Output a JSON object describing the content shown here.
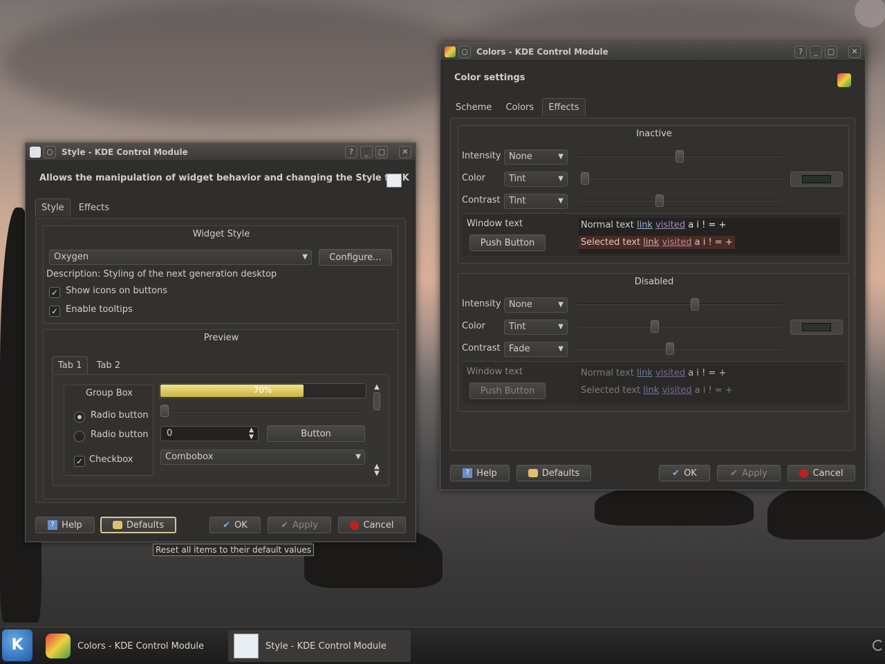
{
  "desktop": {},
  "style_window": {
    "title": "Style - KDE Control Module",
    "header": "Allows the manipulation of widget behavior and changing the Style for K",
    "tabs": [
      "Style",
      "Effects"
    ],
    "widget_style_group": "Widget Style",
    "style_combo": "Oxygen",
    "configure_label": "Configure...",
    "description": "Description: Styling of the next generation desktop",
    "show_icons_label": "Show icons on buttons",
    "enable_tooltips_label": "Enable tooltips",
    "preview_group": "Preview",
    "preview_tabs": [
      "Tab 1",
      "Tab 2"
    ],
    "group_box_label": "Group Box",
    "radio1": "Radio button",
    "radio2": "Radio button",
    "checkbox": "Checkbox",
    "progress_text": "70%",
    "progress_value": 0.7,
    "spin_value": "0",
    "button_label": "Button",
    "combobox_label": "Combobox",
    "buttons": {
      "help": "Help",
      "defaults": "Defaults",
      "ok": "OK",
      "apply": "Apply",
      "cancel": "Cancel"
    },
    "tooltip": "Reset all items to their default values"
  },
  "colors_window": {
    "title": "Colors - KDE Control Module",
    "header": "Color settings",
    "tabs": [
      "Scheme",
      "Colors",
      "Effects"
    ],
    "inactive": {
      "title": "Inactive",
      "intensity_label": "Intensity",
      "intensity_value": "None",
      "color_label": "Color",
      "color_value": "Tint",
      "contrast_label": "Contrast",
      "contrast_value": "Tint"
    },
    "disabled": {
      "title": "Disabled",
      "intensity_label": "Intensity",
      "intensity_value": "None",
      "color_label": "Color",
      "color_value": "Tint",
      "contrast_label": "Contrast",
      "contrast_value": "Fade"
    },
    "preview": {
      "window_text": "Window text",
      "push_button": "Push Button",
      "normal_text": "Normal text",
      "selected_text": "Selected text",
      "link": "link",
      "visited": "visited",
      "symbols": "a i ! = +"
    },
    "buttons": {
      "help": "Help",
      "defaults": "Defaults",
      "ok": "OK",
      "apply": "Apply",
      "cancel": "Cancel"
    }
  },
  "taskbar": {
    "tasks": [
      "Colors - KDE Control Module",
      "Style - KDE Control Module"
    ]
  }
}
